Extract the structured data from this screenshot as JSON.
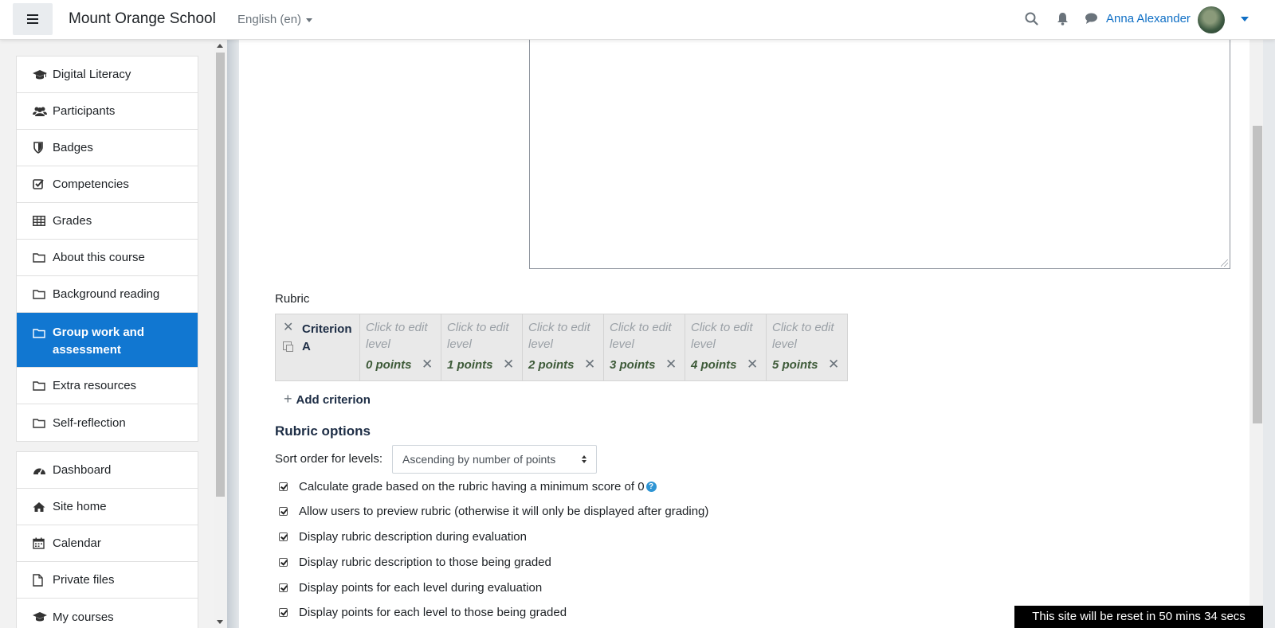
{
  "header": {
    "site_name": "Mount Orange School",
    "language": "English (en)",
    "user_name": "Anna Alexander"
  },
  "drawer": {
    "course_items": [
      {
        "label": "Digital Literacy",
        "icon": "graduation-cap-icon"
      },
      {
        "label": "Participants",
        "icon": "users-icon"
      },
      {
        "label": "Badges",
        "icon": "shield-icon"
      },
      {
        "label": "Competencies",
        "icon": "check-square-icon"
      },
      {
        "label": "Grades",
        "icon": "table-icon"
      },
      {
        "label": "About this course",
        "icon": "folder-icon"
      },
      {
        "label": "Background reading",
        "icon": "folder-icon"
      },
      {
        "label": "Group work and assessment",
        "icon": "folder-icon",
        "active": true
      },
      {
        "label": "Extra resources",
        "icon": "folder-icon"
      },
      {
        "label": "Self-reflection",
        "icon": "folder-icon"
      }
    ],
    "site_items": [
      {
        "label": "Dashboard",
        "icon": "tachometer-icon"
      },
      {
        "label": "Site home",
        "icon": "home-icon"
      },
      {
        "label": "Calendar",
        "icon": "calendar-icon"
      },
      {
        "label": "Private files",
        "icon": "file-icon"
      },
      {
        "label": "My courses",
        "icon": "graduation-cap-icon"
      }
    ]
  },
  "rubric": {
    "label": "Rubric",
    "criterion": "Criterion A",
    "levels": [
      {
        "text": "Click to edit level",
        "points": "0 points"
      },
      {
        "text": "Click to edit level",
        "points": "1 points"
      },
      {
        "text": "Click to edit level",
        "points": "2 points"
      },
      {
        "text": "Click to edit level",
        "points": "3 points"
      },
      {
        "text": "Click to edit level",
        "points": "4 points"
      },
      {
        "text": "Click to edit level",
        "points": "5 points"
      }
    ],
    "add_criterion": "Add criterion"
  },
  "options": {
    "title": "Rubric options",
    "sort_label": "Sort order for levels:",
    "sort_value": "Ascending by number of points",
    "checkboxes": [
      {
        "label": "Calculate grade based on the rubric having a minimum score of 0",
        "checked": true,
        "help": true
      },
      {
        "label": "Allow users to preview rubric (otherwise it will only be displayed after grading)",
        "checked": true
      },
      {
        "label": "Display rubric description during evaluation",
        "checked": true
      },
      {
        "label": "Display rubric description to those being graded",
        "checked": true
      },
      {
        "label": "Display points for each level during evaluation",
        "checked": true
      },
      {
        "label": "Display points for each level to those being graded",
        "checked": true
      }
    ]
  },
  "notice": "This site will be reset in 50 mins 34 secs",
  "colors": {
    "accent": "#1177d1",
    "link": "#0f6fc5",
    "points": "#3d5a38",
    "help": "#2f95d4"
  }
}
